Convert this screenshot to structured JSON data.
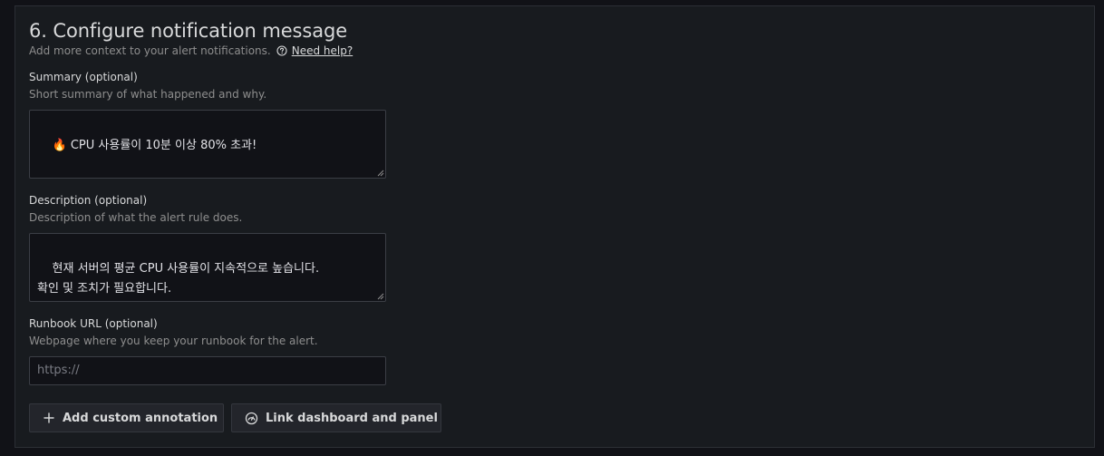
{
  "section": {
    "title": "6. Configure notification message",
    "subtitle": "Add more context to your alert notifications.",
    "help_link": "Need help?"
  },
  "fields": {
    "summary": {
      "label": "Summary (optional)",
      "description": "Short summary of what happened and why.",
      "value": "🔥 CPU 사용률이 10분 이상 80% 초과!"
    },
    "description": {
      "label": "Description (optional)",
      "description": "Description of what the alert rule does.",
      "value": "현재 서버의 평균 CPU 사용률이 지속적으로 높습니다.\n확인 및 조치가 필요합니다."
    },
    "runbook": {
      "label": "Runbook URL (optional)",
      "description": "Webpage where you keep your runbook for the alert.",
      "placeholder": "https://"
    }
  },
  "buttons": {
    "add_annotation": "Add custom annotation",
    "link_dashboard": "Link dashboard and panel"
  },
  "icons": {
    "help": "question-circle-icon",
    "plus": "plus-icon",
    "dashboard": "dashboard-link-icon"
  }
}
